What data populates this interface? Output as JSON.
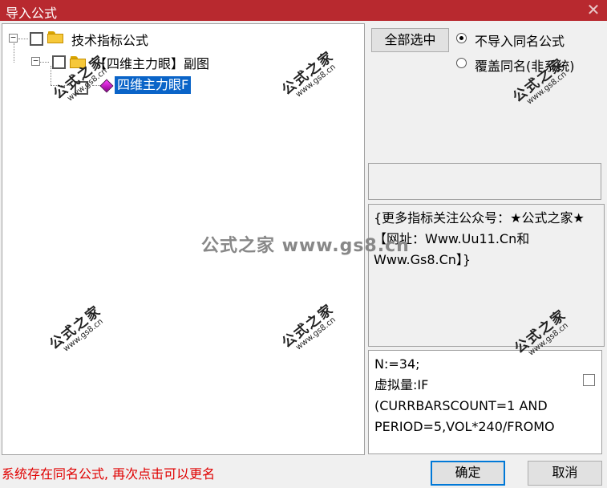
{
  "window": {
    "title": "导入公式",
    "close_glyph": "✕"
  },
  "tree": {
    "root": {
      "label": "技术指标公式",
      "expander": "⊟",
      "checked": false,
      "icon": "folder-icon"
    },
    "group": {
      "label": "【四维主力眼】副图",
      "expander": "⊟",
      "checked": false,
      "icon": "folder-icon"
    },
    "leaf": {
      "label": "四维主力眼F",
      "checked": false,
      "selected": true,
      "icon": "formula-gem-icon"
    }
  },
  "options": {
    "select_all_label": "全部选中",
    "radio_skip_label": "不导入同名公式",
    "radio_overwrite_label": "覆盖同名(非系统)",
    "selected_option": "skip"
  },
  "description_text": "{更多指标关注公众号：★公式之家★【网址：Www.Uu11.Cn和Www.Gs8.Cn】}",
  "formula_text": "N:=34;\n虚拟量:IF\n(CURRBARSCOUNT=1 AND\nPERIOD=5,VOL*240/FROMO",
  "status_message": "系统存在同名公式, 再次点击可以更名",
  "buttons": {
    "ok_label": "确定",
    "cancel_label": "取消"
  },
  "watermarks": {
    "stamp_text": "公式之家",
    "stamp_url": "www.gs8.cn",
    "center_text": "公式之家 www.gs8.cn"
  }
}
